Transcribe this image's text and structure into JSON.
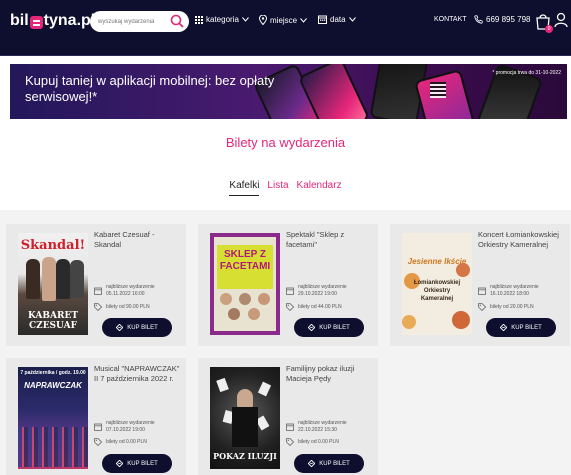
{
  "header": {
    "logo_left": "bil",
    "logo_right": "tyna.pl",
    "search_placeholder": "wyszukaj wydarzenia",
    "nav": {
      "kategoria": "kategoria",
      "miejsce": "miejsce",
      "data": "data"
    },
    "kontakt": "KONTAKT",
    "phone": "669 895 798",
    "cart_count": "0"
  },
  "banner": {
    "text": "Kupuj taniej w aplikacji mobilnej: bez opłaty serwisowej!*",
    "note": "* promocja trwa do 31-10-2022"
  },
  "page_title": "Bilety na wydarzenia",
  "tabs": [
    "Kafelki",
    "Lista",
    "Kalendarz"
  ],
  "labels": {
    "next_event": "najbliższe wydarzenie",
    "buy": "KUP BILET"
  },
  "events": [
    {
      "title": "Kabaret Czesuaf - Skandal",
      "date": "05.11.2022 16:00",
      "price": "bilety od 90.00 PLN",
      "poster_top": "Skandal!",
      "poster_bottom": "KABARET CZESUAF"
    },
    {
      "title": "Spektakl \"Sklep z facetami\"",
      "date": "29.10.2022 19:00",
      "price": "bilety od 44.00 PLN",
      "poster_top": "SKLEP Z FACETAMI",
      "poster_bottom": ""
    },
    {
      "title": "Koncert Łomiankowskiej Orkiestry Kameralnej",
      "date": "16.10.2022 18:00",
      "price": "bilety od 20.00 PLN",
      "poster_top": "Jesienne Ikście",
      "poster_bottom": "Łomiankowskiej Orkiestry Kameralnej"
    },
    {
      "title": "Musical \"NAPRAWCZAK\" II 7 października 2022 r.",
      "date": "07.10.2022 19:00",
      "price": "bilety od 0.00 PLN",
      "poster_top": "7 października / godz. 19.00",
      "poster_bottom": "NAPRAWCZAK"
    },
    {
      "title": "Familijny pokaz iluzji Macieja Pędy",
      "date": "22.10.2022 15:30",
      "price": "bilety od 0.00 PLN",
      "poster_top": "",
      "poster_bottom": "POKAZ ILUZJI"
    }
  ]
}
